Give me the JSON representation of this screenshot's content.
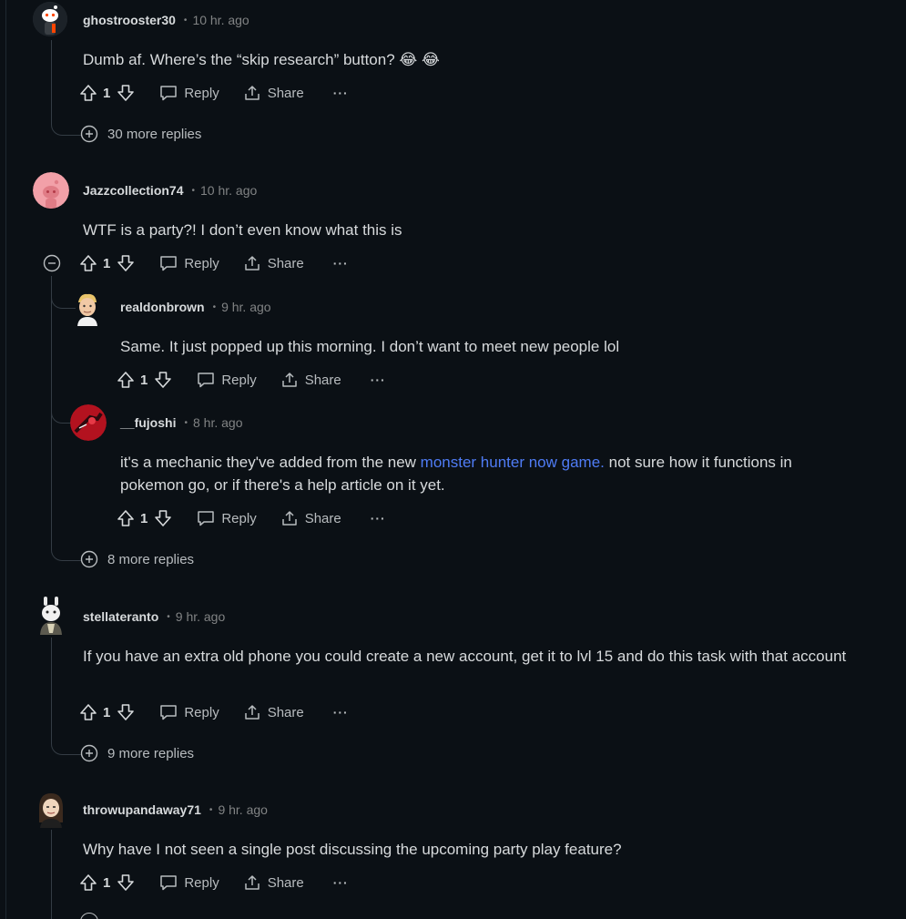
{
  "comments": [
    {
      "username": "ghostrooster30",
      "time": "10 hr. ago",
      "text": "Dumb af. Where’s the “skip research” button? 😂 😂",
      "score": "1",
      "reply_label": "Reply",
      "share_label": "Share",
      "more_label": "···",
      "more_replies": "30 more replies"
    },
    {
      "username": "Jazzcollection74",
      "time": "10 hr. ago",
      "text": "WTF is a party?! I don’t even know what this is",
      "score": "1",
      "reply_label": "Reply",
      "share_label": "Share",
      "more_label": "···",
      "more_replies": "8 more replies",
      "replies": [
        {
          "username": "realdonbrown",
          "time": "9 hr. ago",
          "text": "Same. It just popped up this morning. I don’t want to meet new people lol",
          "score": "1",
          "reply_label": "Reply",
          "share_label": "Share",
          "more_label": "···"
        },
        {
          "username": "__fujoshi",
          "time": "8 hr. ago",
          "text_before": "it's a mechanic they've added from the new ",
          "link_text": "monster hunter now game.",
          "text_after": " not sure how it functions in pokemon go, or if there's a help article on it yet.",
          "score": "1",
          "reply_label": "Reply",
          "share_label": "Share",
          "more_label": "···"
        }
      ]
    },
    {
      "username": "stellateranto",
      "time": "9 hr. ago",
      "text": "If you have an extra old phone you could create a new account, get it to lvl 15 and do this task with that account",
      "score": "1",
      "reply_label": "Reply",
      "share_label": "Share",
      "more_label": "···",
      "more_replies": "9 more replies"
    },
    {
      "username": "throwupandaway71",
      "time": "9 hr. ago",
      "text": "Why have I not seen a single post discussing the upcoming party play feature?",
      "score": "1",
      "reply_label": "Reply",
      "share_label": "Share",
      "more_label": "···"
    }
  ],
  "meta_separator": "•",
  "colors": {
    "background": "#0b1015",
    "text": "#d7dadc",
    "muted": "#818384",
    "link": "#4f7cf5",
    "thread_line": "#343c44"
  }
}
